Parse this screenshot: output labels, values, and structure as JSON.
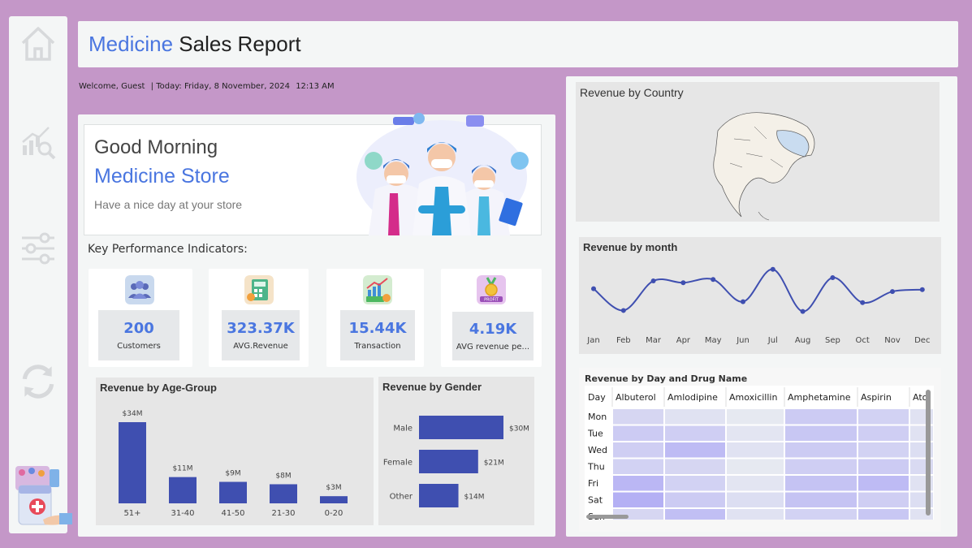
{
  "header": {
    "title_accent": "Medicine",
    "title_rest": "Sales Report"
  },
  "welcome": {
    "greeting": "Welcome, Guest",
    "today": "| Today: Friday, 8 November, 2024",
    "time": "12:13 AM"
  },
  "sidebar": {
    "items": [
      {
        "icon": "home-icon"
      },
      {
        "icon": "analytics-search-icon"
      },
      {
        "icon": "sliders-icon"
      },
      {
        "icon": "refresh-icon"
      }
    ]
  },
  "greeting_card": {
    "line1": "Good Morning",
    "line2": "Medicine Store",
    "line3": "Have a nice day at your store"
  },
  "kpi_heading": "Key Performance Indicators:",
  "kpis": [
    {
      "value": "200",
      "label": "Customers",
      "icon": "customers-icon"
    },
    {
      "value": "323.37K",
      "label": "AVG.Revenue",
      "icon": "calculator-icon"
    },
    {
      "value": "15.44K",
      "label": "Transaction",
      "icon": "transaction-chart-icon"
    },
    {
      "value": "4.19K",
      "label": "AVG revenue pe...",
      "icon": "profit-medal-icon",
      "icon_text": "PROFIT"
    }
  ],
  "colors": {
    "accent": "#4a76e0",
    "bar": "#3f4fb0",
    "page_bg": "#c497c8",
    "panel_bg": "#f4f6f6"
  },
  "age_chart": {
    "title": "Revenue by Age-Group",
    "chart_data": {
      "type": "bar",
      "categories": [
        "51+",
        "31-40",
        "41-50",
        "21-30",
        "0-20"
      ],
      "values": [
        34,
        11,
        9,
        8,
        3
      ],
      "labels": [
        "$34M",
        "$11M",
        "$9M",
        "$8M",
        "$3M"
      ],
      "ylim": [
        0,
        34
      ]
    }
  },
  "gender_chart": {
    "title": "Revenue by Gender",
    "chart_data": {
      "type": "bar",
      "orientation": "horizontal",
      "categories": [
        "Male",
        "Female",
        "Other"
      ],
      "values": [
        30,
        21,
        14
      ],
      "labels": [
        "$30M",
        "$21M",
        "$14M"
      ],
      "xlim": [
        0,
        30
      ]
    }
  },
  "country_chart": {
    "title": "Revenue by Country"
  },
  "month_chart": {
    "title": "Revenue by month",
    "chart_data": {
      "type": "line",
      "categories": [
        "Jan",
        "Feb",
        "Mar",
        "Apr",
        "May",
        "Jun",
        "Jul",
        "Aug",
        "Sep",
        "Oct",
        "Nov",
        "Dec"
      ],
      "values": [
        0.55,
        0.08,
        0.72,
        0.68,
        0.75,
        0.27,
        0.97,
        0.06,
        0.79,
        0.25,
        0.49,
        0.53
      ],
      "ylim": [
        0,
        1
      ]
    }
  },
  "drug_chart": {
    "title": "Revenue by Day and Drug Name",
    "chart_data": {
      "type": "heatmap",
      "columns": [
        "Day",
        "Albuterol",
        "Amlodipine",
        "Amoxicillin",
        "Amphetamine",
        "Aspirin",
        "Ato"
      ],
      "rows": [
        "Mon",
        "Tue",
        "Wed",
        "Thu",
        "Fri",
        "Sat",
        "Sun"
      ],
      "values": [
        [
          0.35,
          0.2,
          0.1,
          0.5,
          0.4,
          0.2
        ],
        [
          0.5,
          0.45,
          0.15,
          0.55,
          0.45,
          0.2
        ],
        [
          0.45,
          0.7,
          0.2,
          0.5,
          0.4,
          0.25
        ],
        [
          0.4,
          0.35,
          0.1,
          0.45,
          0.5,
          0.3
        ],
        [
          0.75,
          0.4,
          0.15,
          0.6,
          0.7,
          0.2
        ],
        [
          0.85,
          0.5,
          0.25,
          0.6,
          0.45,
          0.25
        ],
        [
          0.35,
          0.65,
          0.2,
          0.4,
          0.55,
          0.2
        ]
      ]
    }
  }
}
